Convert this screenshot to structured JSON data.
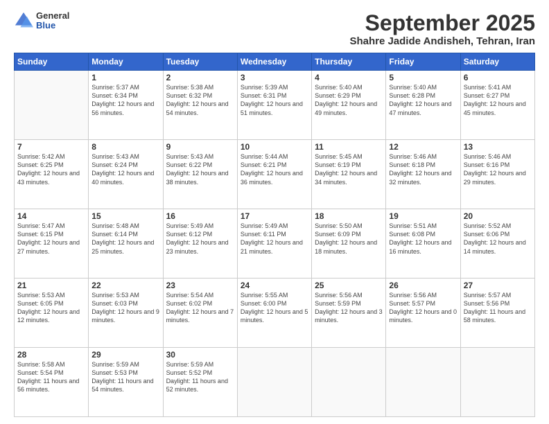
{
  "header": {
    "logo_general": "General",
    "logo_blue": "Blue",
    "month_title": "September 2025",
    "subtitle": "Shahre Jadide Andisheh, Tehran, Iran"
  },
  "days_of_week": [
    "Sunday",
    "Monday",
    "Tuesday",
    "Wednesday",
    "Thursday",
    "Friday",
    "Saturday"
  ],
  "weeks": [
    [
      {
        "day": "",
        "sunrise": "",
        "sunset": "",
        "daylight": ""
      },
      {
        "day": "1",
        "sunrise": "Sunrise: 5:37 AM",
        "sunset": "Sunset: 6:34 PM",
        "daylight": "Daylight: 12 hours and 56 minutes."
      },
      {
        "day": "2",
        "sunrise": "Sunrise: 5:38 AM",
        "sunset": "Sunset: 6:32 PM",
        "daylight": "Daylight: 12 hours and 54 minutes."
      },
      {
        "day": "3",
        "sunrise": "Sunrise: 5:39 AM",
        "sunset": "Sunset: 6:31 PM",
        "daylight": "Daylight: 12 hours and 51 minutes."
      },
      {
        "day": "4",
        "sunrise": "Sunrise: 5:40 AM",
        "sunset": "Sunset: 6:29 PM",
        "daylight": "Daylight: 12 hours and 49 minutes."
      },
      {
        "day": "5",
        "sunrise": "Sunrise: 5:40 AM",
        "sunset": "Sunset: 6:28 PM",
        "daylight": "Daylight: 12 hours and 47 minutes."
      },
      {
        "day": "6",
        "sunrise": "Sunrise: 5:41 AM",
        "sunset": "Sunset: 6:27 PM",
        "daylight": "Daylight: 12 hours and 45 minutes."
      }
    ],
    [
      {
        "day": "7",
        "sunrise": "Sunrise: 5:42 AM",
        "sunset": "Sunset: 6:25 PM",
        "daylight": "Daylight: 12 hours and 43 minutes."
      },
      {
        "day": "8",
        "sunrise": "Sunrise: 5:43 AM",
        "sunset": "Sunset: 6:24 PM",
        "daylight": "Daylight: 12 hours and 40 minutes."
      },
      {
        "day": "9",
        "sunrise": "Sunrise: 5:43 AM",
        "sunset": "Sunset: 6:22 PM",
        "daylight": "Daylight: 12 hours and 38 minutes."
      },
      {
        "day": "10",
        "sunrise": "Sunrise: 5:44 AM",
        "sunset": "Sunset: 6:21 PM",
        "daylight": "Daylight: 12 hours and 36 minutes."
      },
      {
        "day": "11",
        "sunrise": "Sunrise: 5:45 AM",
        "sunset": "Sunset: 6:19 PM",
        "daylight": "Daylight: 12 hours and 34 minutes."
      },
      {
        "day": "12",
        "sunrise": "Sunrise: 5:46 AM",
        "sunset": "Sunset: 6:18 PM",
        "daylight": "Daylight: 12 hours and 32 minutes."
      },
      {
        "day": "13",
        "sunrise": "Sunrise: 5:46 AM",
        "sunset": "Sunset: 6:16 PM",
        "daylight": "Daylight: 12 hours and 29 minutes."
      }
    ],
    [
      {
        "day": "14",
        "sunrise": "Sunrise: 5:47 AM",
        "sunset": "Sunset: 6:15 PM",
        "daylight": "Daylight: 12 hours and 27 minutes."
      },
      {
        "day": "15",
        "sunrise": "Sunrise: 5:48 AM",
        "sunset": "Sunset: 6:14 PM",
        "daylight": "Daylight: 12 hours and 25 minutes."
      },
      {
        "day": "16",
        "sunrise": "Sunrise: 5:49 AM",
        "sunset": "Sunset: 6:12 PM",
        "daylight": "Daylight: 12 hours and 23 minutes."
      },
      {
        "day": "17",
        "sunrise": "Sunrise: 5:49 AM",
        "sunset": "Sunset: 6:11 PM",
        "daylight": "Daylight: 12 hours and 21 minutes."
      },
      {
        "day": "18",
        "sunrise": "Sunrise: 5:50 AM",
        "sunset": "Sunset: 6:09 PM",
        "daylight": "Daylight: 12 hours and 18 minutes."
      },
      {
        "day": "19",
        "sunrise": "Sunrise: 5:51 AM",
        "sunset": "Sunset: 6:08 PM",
        "daylight": "Daylight: 12 hours and 16 minutes."
      },
      {
        "day": "20",
        "sunrise": "Sunrise: 5:52 AM",
        "sunset": "Sunset: 6:06 PM",
        "daylight": "Daylight: 12 hours and 14 minutes."
      }
    ],
    [
      {
        "day": "21",
        "sunrise": "Sunrise: 5:53 AM",
        "sunset": "Sunset: 6:05 PM",
        "daylight": "Daylight: 12 hours and 12 minutes."
      },
      {
        "day": "22",
        "sunrise": "Sunrise: 5:53 AM",
        "sunset": "Sunset: 6:03 PM",
        "daylight": "Daylight: 12 hours and 9 minutes."
      },
      {
        "day": "23",
        "sunrise": "Sunrise: 5:54 AM",
        "sunset": "Sunset: 6:02 PM",
        "daylight": "Daylight: 12 hours and 7 minutes."
      },
      {
        "day": "24",
        "sunrise": "Sunrise: 5:55 AM",
        "sunset": "Sunset: 6:00 PM",
        "daylight": "Daylight: 12 hours and 5 minutes."
      },
      {
        "day": "25",
        "sunrise": "Sunrise: 5:56 AM",
        "sunset": "Sunset: 5:59 PM",
        "daylight": "Daylight: 12 hours and 3 minutes."
      },
      {
        "day": "26",
        "sunrise": "Sunrise: 5:56 AM",
        "sunset": "Sunset: 5:57 PM",
        "daylight": "Daylight: 12 hours and 0 minutes."
      },
      {
        "day": "27",
        "sunrise": "Sunrise: 5:57 AM",
        "sunset": "Sunset: 5:56 PM",
        "daylight": "Daylight: 11 hours and 58 minutes."
      }
    ],
    [
      {
        "day": "28",
        "sunrise": "Sunrise: 5:58 AM",
        "sunset": "Sunset: 5:54 PM",
        "daylight": "Daylight: 11 hours and 56 minutes."
      },
      {
        "day": "29",
        "sunrise": "Sunrise: 5:59 AM",
        "sunset": "Sunset: 5:53 PM",
        "daylight": "Daylight: 11 hours and 54 minutes."
      },
      {
        "day": "30",
        "sunrise": "Sunrise: 5:59 AM",
        "sunset": "Sunset: 5:52 PM",
        "daylight": "Daylight: 11 hours and 52 minutes."
      },
      {
        "day": "",
        "sunrise": "",
        "sunset": "",
        "daylight": ""
      },
      {
        "day": "",
        "sunrise": "",
        "sunset": "",
        "daylight": ""
      },
      {
        "day": "",
        "sunrise": "",
        "sunset": "",
        "daylight": ""
      },
      {
        "day": "",
        "sunrise": "",
        "sunset": "",
        "daylight": ""
      }
    ]
  ]
}
